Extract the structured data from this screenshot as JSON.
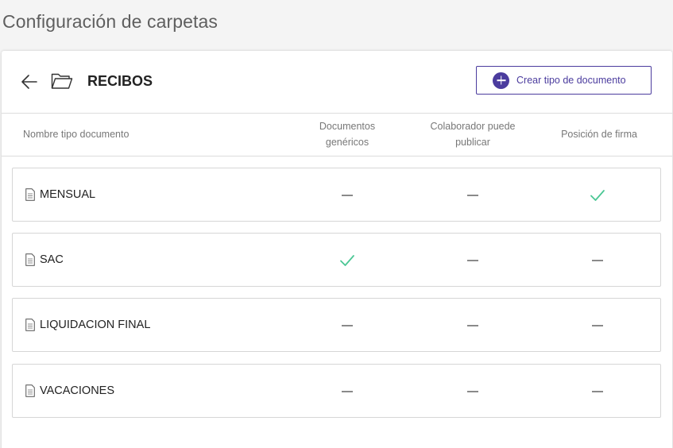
{
  "page": {
    "title": "Configuración de carpetas"
  },
  "header": {
    "folder_name": "RECIBOS",
    "create_button_label": "Crear tipo de documento",
    "back_icon": "arrow-left-icon",
    "folder_icon": "folder-open-icon"
  },
  "columns": {
    "name": "Nombre tipo documento",
    "generic_line1": "Documentos",
    "generic_line2": "genéricos",
    "collab_line1": "Colaborador puede",
    "collab_line2": "publicar",
    "signature": "Posición de firma"
  },
  "rows": [
    {
      "label": "MENSUAL",
      "generic": false,
      "collaborator": false,
      "signature": true
    },
    {
      "label": "SAC",
      "generic": true,
      "collaborator": false,
      "signature": false
    },
    {
      "label": "LIQUIDACION FINAL",
      "generic": false,
      "collaborator": false,
      "signature": false
    },
    {
      "label": "VACACIONES",
      "generic": false,
      "collaborator": false,
      "signature": false
    }
  ],
  "colors": {
    "accent": "#4b3c9e",
    "check": "#4cc795",
    "dash": "#8a8a8a"
  }
}
